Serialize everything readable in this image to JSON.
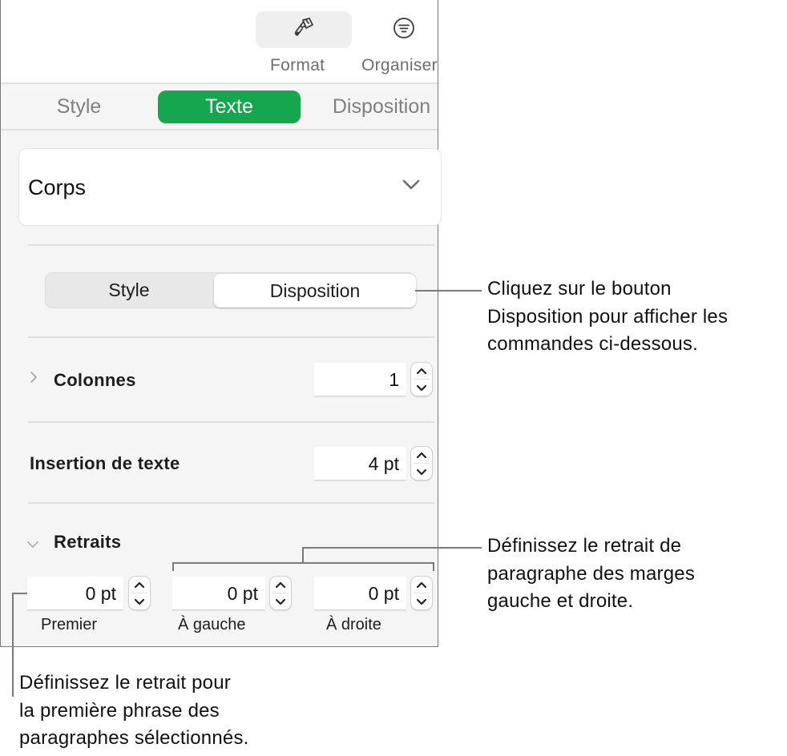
{
  "toolbar": {
    "format": {
      "label": "Format",
      "icon": "paintbrush-icon",
      "active": true
    },
    "organise": {
      "label": "Organiser",
      "icon": "organise-icon",
      "active": false
    }
  },
  "tabs": [
    {
      "label": "Style",
      "active": false
    },
    {
      "label": "Texte",
      "active": true
    },
    {
      "label": "Disposition",
      "active": false
    }
  ],
  "paragraph_style": {
    "value": "Corps",
    "icon": "chevron-down-icon"
  },
  "segmented": [
    {
      "label": "Style",
      "active": false
    },
    {
      "label": "Disposition",
      "active": true
    }
  ],
  "columns": {
    "label": "Colonnes",
    "value": "1",
    "expanded": false
  },
  "text_inset": {
    "label": "Insertion de texte",
    "value": "4 pt"
  },
  "indents": {
    "label": "Retraits",
    "expanded": true,
    "fields": [
      {
        "label": "Premier",
        "value": "0 pt"
      },
      {
        "label": "À gauche",
        "value": "0 pt"
      },
      {
        "label": "À droite",
        "value": "0 pt"
      }
    ]
  },
  "callouts": {
    "layout_button": [
      "Cliquez sur le bouton",
      "Disposition pour afficher les",
      "commandes ci-dessous."
    ],
    "left_right": [
      "Définissez le retrait de",
      "paragraphe des marges",
      "gauche et droite."
    ],
    "first_line": [
      "Définissez le retrait pour",
      "la première phrase des",
      "paragraphes sélectionnés."
    ]
  },
  "colors": {
    "accent": "#15a74f",
    "panel_bg": "#f5f5f5",
    "callout_line": "#7a7a7a"
  }
}
